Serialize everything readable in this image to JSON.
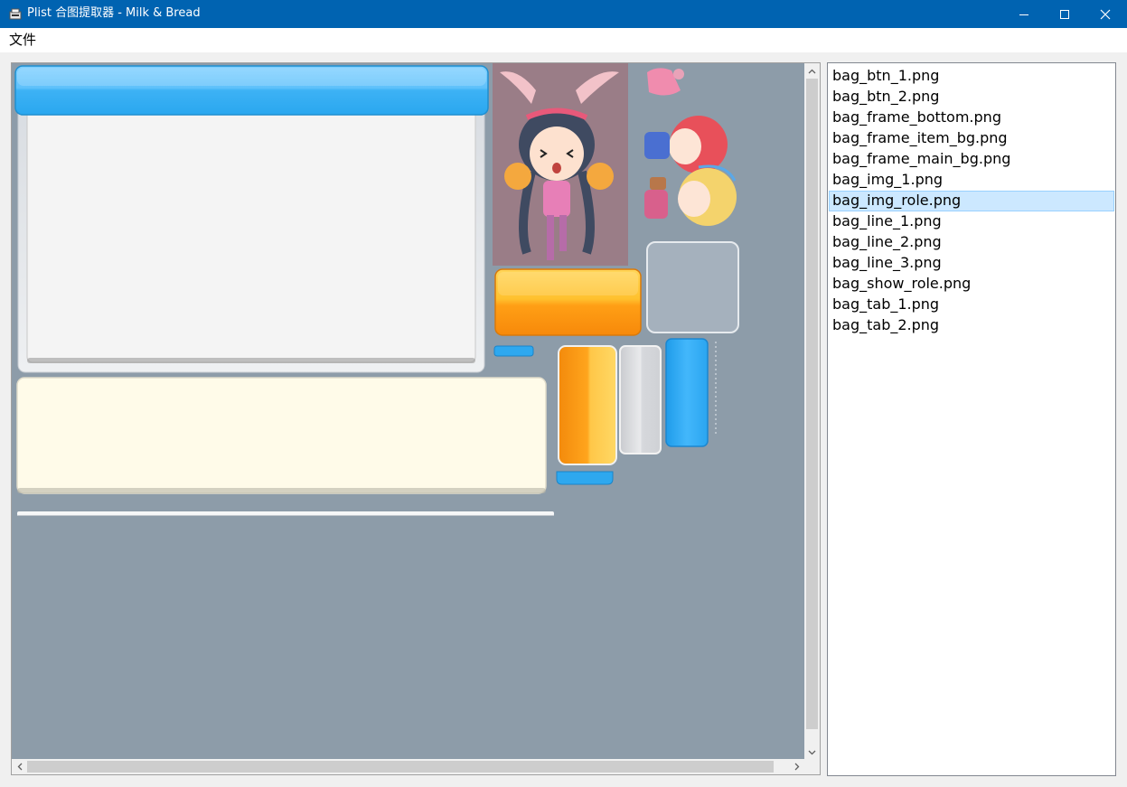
{
  "window": {
    "title": "Plist 合图提取器 - Milk & Bread",
    "minimize_icon": "minimize-icon",
    "maximize_icon": "maximize-icon",
    "close_icon": "close-icon"
  },
  "menu": {
    "file_label": "文件"
  },
  "files": [
    {
      "label": "bag_btn_1.png",
      "selected": false
    },
    {
      "label": "bag_btn_2.png",
      "selected": false
    },
    {
      "label": "bag_frame_bottom.png",
      "selected": false
    },
    {
      "label": "bag_frame_item_bg.png",
      "selected": false
    },
    {
      "label": "bag_frame_main_bg.png",
      "selected": false
    },
    {
      "label": "bag_img_1.png",
      "selected": false
    },
    {
      "label": "bag_img_role.png",
      "selected": true
    },
    {
      "label": "bag_line_1.png",
      "selected": false
    },
    {
      "label": "bag_line_2.png",
      "selected": false
    },
    {
      "label": "bag_line_3.png",
      "selected": false
    },
    {
      "label": "bag_show_role.png",
      "selected": false
    },
    {
      "label": "bag_tab_1.png",
      "selected": false
    },
    {
      "label": "bag_tab_2.png",
      "selected": false
    }
  ],
  "colors": {
    "titlebar": "#0063b1",
    "canvas_bg": "#8d9ca9",
    "selection": "#cce8ff"
  }
}
